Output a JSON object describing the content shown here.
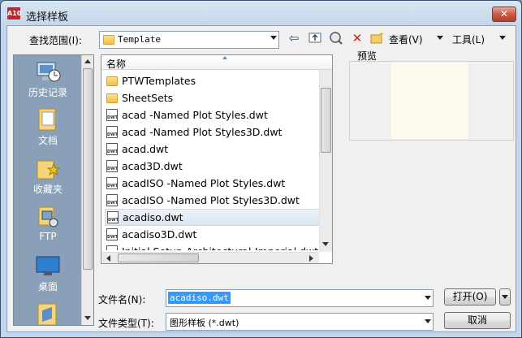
{
  "window": {
    "title": "选择样板",
    "app_icon_text": "A10",
    "close_symbol": "✕"
  },
  "lookin": {
    "label": "查找范围(I):",
    "value": "Template",
    "view_label": "查看(V)",
    "tools_label": "工具(L)"
  },
  "places": [
    {
      "label": "历史记录",
      "icon": "history-icon"
    },
    {
      "label": "文档",
      "icon": "documents-icon"
    },
    {
      "label": "收藏夹",
      "icon": "favorites-icon"
    },
    {
      "label": "FTP",
      "icon": "ftp-icon"
    },
    {
      "label": "桌面",
      "icon": "desktop-icon"
    }
  ],
  "filelist": {
    "column_header": "名称",
    "files": [
      {
        "name": "PTWTemplates",
        "type": "folder"
      },
      {
        "name": "SheetSets",
        "type": "folder"
      },
      {
        "name": "acad -Named Plot Styles.dwt",
        "type": "dwt"
      },
      {
        "name": "acad -Named Plot Styles3D.dwt",
        "type": "dwt"
      },
      {
        "name": "acad.dwt",
        "type": "dwt"
      },
      {
        "name": "acad3D.dwt",
        "type": "dwt"
      },
      {
        "name": "acadISO -Named Plot Styles.dwt",
        "type": "dwt"
      },
      {
        "name": "acadISO -Named Plot Styles3D.dwt",
        "type": "dwt"
      },
      {
        "name": "acadiso.dwt",
        "type": "dwt",
        "selected": true
      },
      {
        "name": "acadiso3D.dwt",
        "type": "dwt"
      },
      {
        "name": "Initial Setup-Architectural-Imperial.dwt",
        "type": "dwt"
      }
    ],
    "dwt_icon_text": "DWT"
  },
  "preview": {
    "label": "预览"
  },
  "filename": {
    "label": "文件名(N):",
    "value": "acadiso.dwt"
  },
  "filetype": {
    "label": "文件类型(T):",
    "value": "图形样板 (*.dwt)"
  },
  "buttons": {
    "open": "打开(O)",
    "cancel": "取消"
  },
  "colors": {
    "selection": "#3399ff",
    "places_bg": "#8aa0b8",
    "preview_bg": "#fdfbee"
  }
}
